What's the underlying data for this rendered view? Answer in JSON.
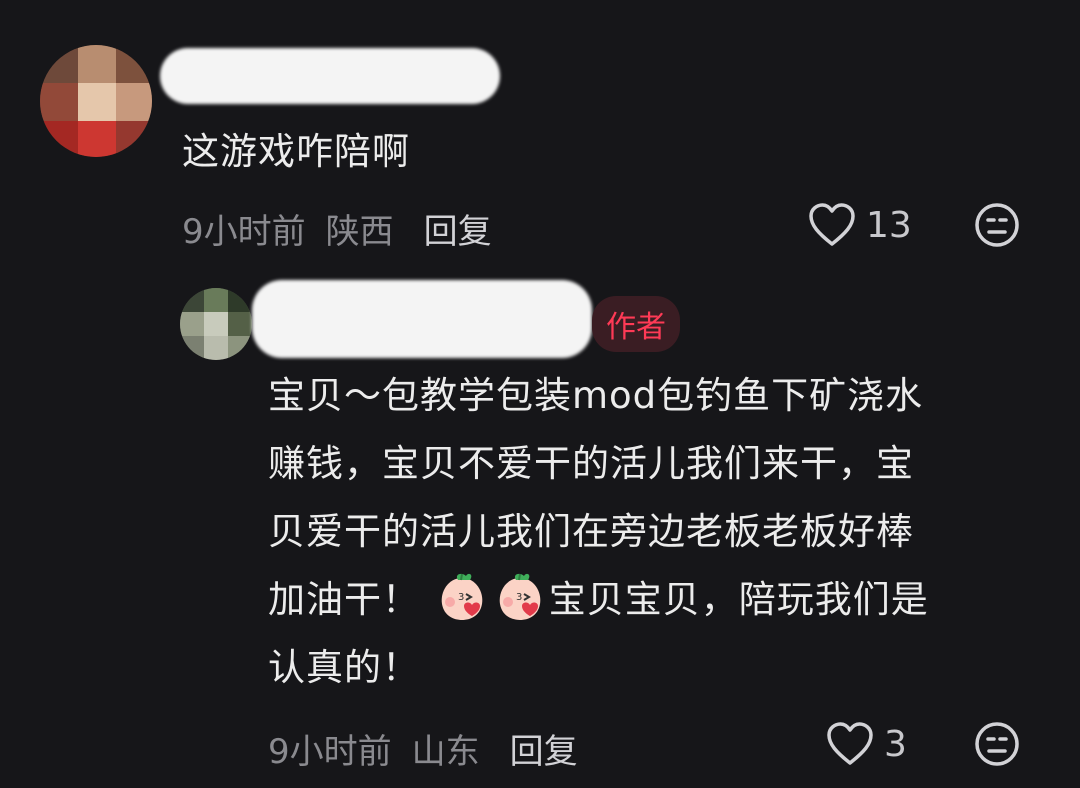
{
  "comments": [
    {
      "text": "这游戏咋陪啊",
      "time": "9小时前",
      "location": "陕西",
      "reply_label": "回复",
      "likes": "13"
    },
    {
      "author_badge": "作者",
      "text_lines": [
        "宝贝～包教学包装mod包钓鱼下矿浇水",
        "赚钱，宝贝不爱干的活儿我们来干，宝",
        "贝爱干的活儿我们在旁边老板老板好棒",
        "加油干！",
        "宝贝宝贝，陪玩我们是",
        "认真的！"
      ],
      "emoji": "peach-kiss-emoji",
      "time": "9小时前",
      "location": "山东",
      "reply_label": "回复",
      "likes": "3"
    }
  ],
  "colors": {
    "background": "#161619",
    "author_badge_text": "#ff3a56",
    "author_badge_bg": "#3a1d23"
  }
}
